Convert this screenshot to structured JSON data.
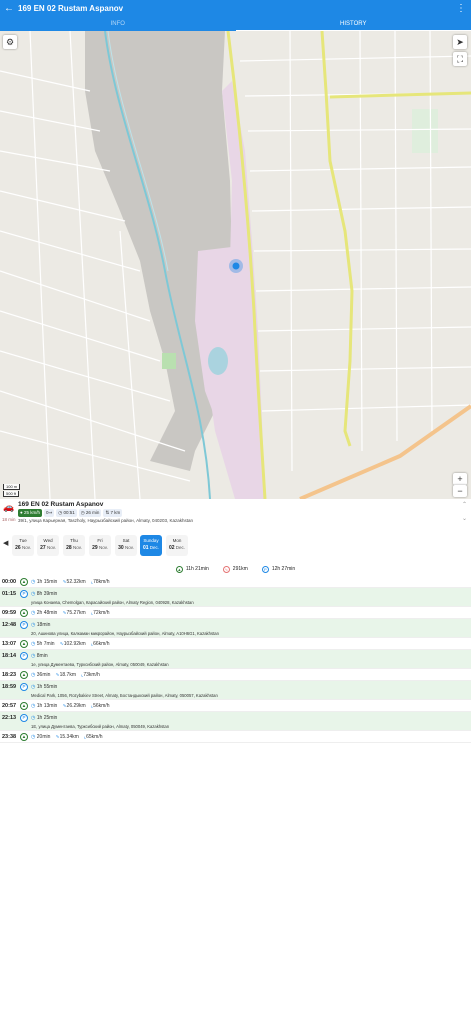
{
  "header": {
    "title": "169 EN 02 Rustam Aspanov",
    "back_icon": "arrow-left-icon",
    "more_icon": "more-vert-icon"
  },
  "tabs": [
    {
      "label": "INFO"
    },
    {
      "label": "HISTORY"
    }
  ],
  "map": {
    "scale_m": "100 m",
    "scale_ft": "500 ft"
  },
  "vehicle": {
    "name": "169 EN 02 Rustam Aspanov",
    "speed": "25 km/h",
    "direction": "0",
    "time1": "00:51",
    "time2": "26 min",
    "distance": "7 km",
    "ago": "18 min",
    "address": "39/1, улица Карьерная, Taszholy, Наурызбайский район, Almaty, 040203, Kazakhstan"
  },
  "days": [
    {
      "name": "Tue",
      "date": "26",
      "month": "Nov."
    },
    {
      "name": "Wed",
      "date": "27",
      "month": "Nov."
    },
    {
      "name": "Thu",
      "date": "28",
      "month": "Nov."
    },
    {
      "name": "Fri",
      "date": "29",
      "month": "Nov."
    },
    {
      "name": "Sat",
      "date": "30",
      "month": "Nov."
    },
    {
      "name": "Sunday",
      "date": "01",
      "month": "Dec."
    },
    {
      "name": "Mon",
      "date": "02",
      "month": "Dec."
    }
  ],
  "summary": {
    "driving": "11h 21min",
    "distance": "291km",
    "parking": "12h 27min"
  },
  "timeline": [
    {
      "type": "trip",
      "time": "00:00",
      "duration": "1h 15min",
      "distance": "52.32km",
      "speed": "78km/h"
    },
    {
      "type": "stop",
      "time": "01:15",
      "duration": "8h 39min",
      "address": "улица Конаева, Chemolgan, Карасайский район, Almaty Region, 040928, Kazakhstan"
    },
    {
      "type": "trip",
      "time": "09:59",
      "duration": "2h 48min",
      "distance": "75.27km",
      "speed": "72km/h"
    },
    {
      "type": "stop",
      "time": "12:48",
      "duration": "18min",
      "address": "20, Ашинова улица, Калкаман микрорайон, Наурызбайский район, Almaty, A10H6G1, Kazakhstan"
    },
    {
      "type": "trip",
      "time": "13:07",
      "duration": "5h 7min",
      "distance": "102.92km",
      "speed": "66km/h"
    },
    {
      "type": "stop",
      "time": "18:14",
      "duration": "8min",
      "address": "1е, улица Дументаева, Турксибский район, Almaty, 050049, Kazakhstan"
    },
    {
      "type": "trip",
      "time": "18:23",
      "duration": "36min",
      "distance": "18.7km",
      "speed": "73km/h"
    },
    {
      "type": "stop",
      "time": "18:59",
      "duration": "1h 55min",
      "address": "Medical Park, 1056, Rozybakiev Street, Almaty, Бостандыкский район, Almaty, 050057, Kazakhstan"
    },
    {
      "type": "trip",
      "time": "20:57",
      "duration": "1h 13min",
      "distance": "26.29km",
      "speed": "56km/h"
    },
    {
      "type": "stop",
      "time": "22:13",
      "duration": "1h 25min",
      "address": "1Е, улица Дументаева, Турксибский район, Almaty, 050049, Kazakhstan"
    },
    {
      "type": "trip",
      "time": "23:38",
      "duration": "20min",
      "distance": "15.34km",
      "speed": "65km/h"
    }
  ],
  "colors": {
    "accent": "#1e88e5",
    "stop_bg": "#e8f5e9",
    "trip_green": "#2e7d32",
    "route_yellow": "#e6e67a"
  }
}
